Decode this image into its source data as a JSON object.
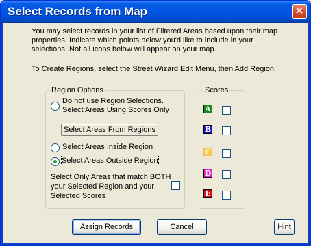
{
  "window": {
    "title": "Select Records from Map",
    "close_glyph": "✕"
  },
  "intro": {
    "line1": "You may select records in your list of Filtered Areas based upon their map",
    "line2": "properties.  Indicate which points below you'd like to include in your",
    "line3": "selections.  Not all icons below will appear on your map.",
    "line4": "To Create Regions, select the Street Wizard Edit Menu, then Add Region."
  },
  "region_options": {
    "legend": "Region Options",
    "opt_no_region_line1": "Do not use Region Selections.",
    "opt_no_region_line2": "Select Areas Using Scores Only",
    "select_from_regions_button": "Select Areas From Regions",
    "opt_inside": "Select Areas Inside Region",
    "opt_outside": "Select Areas Outside Region",
    "selected_option": "outside",
    "both_line1": "Select Only Areas that match BOTH",
    "both_line2": "your Selected Region and your",
    "both_line3": "Selected Scores",
    "both_checked": false
  },
  "scores": {
    "legend": "Scores",
    "items": [
      {
        "letter": "A",
        "color": "#1c8a1c",
        "checked": false
      },
      {
        "letter": "B",
        "color": "#1414c8",
        "checked": false
      },
      {
        "letter": "C",
        "color": "#f4c84a",
        "checked": false
      },
      {
        "letter": "D",
        "color": "#e020c8",
        "checked": false
      },
      {
        "letter": "E",
        "color": "#d01010",
        "checked": false
      }
    ]
  },
  "buttons": {
    "assign": "Assign Records",
    "cancel": "Cancel",
    "hint": "Hint"
  }
}
